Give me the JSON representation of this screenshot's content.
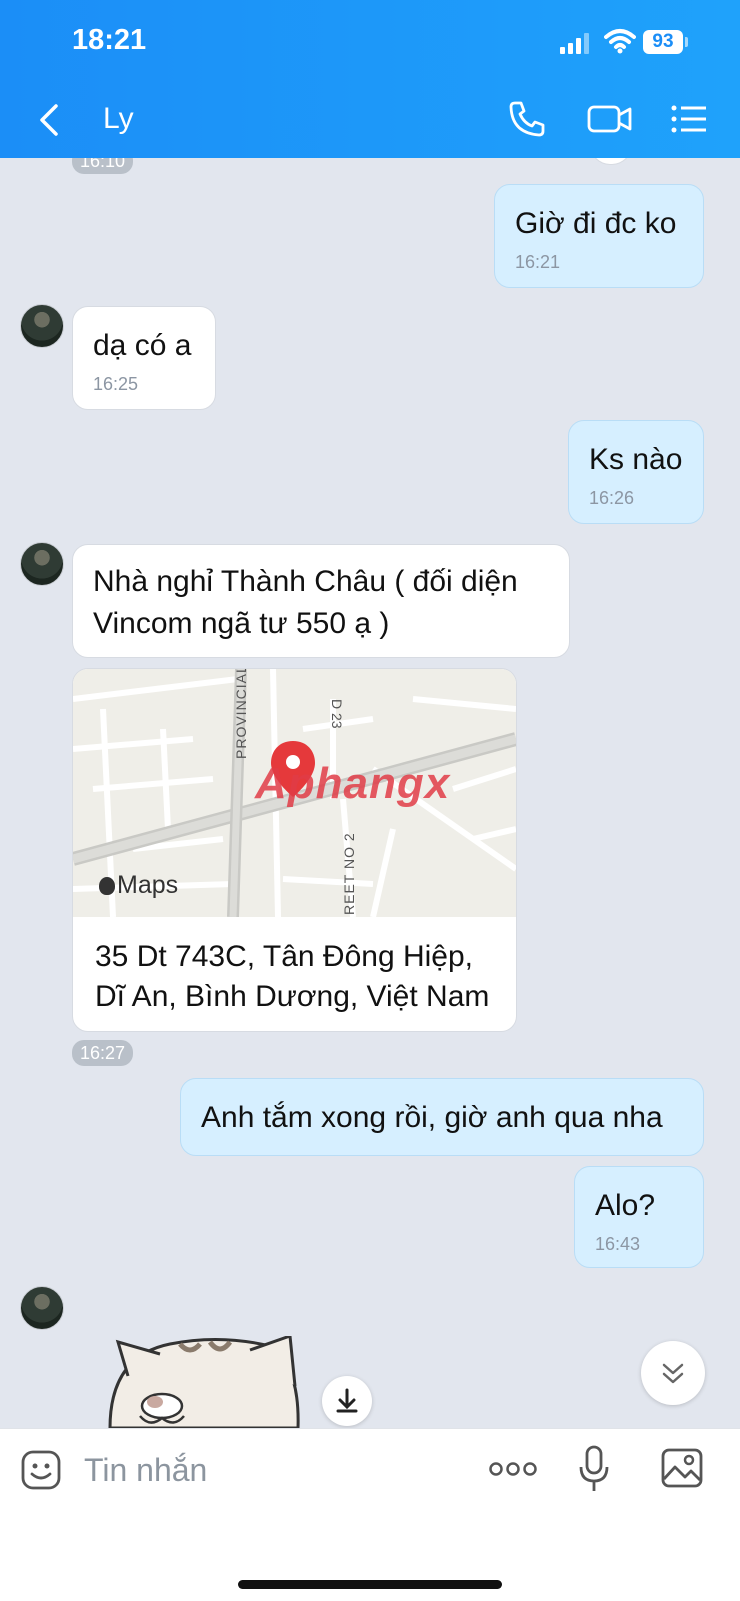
{
  "status_bar": {
    "time": "18:21",
    "battery": "93"
  },
  "header": {
    "contact_name": "Ly"
  },
  "messages": {
    "top_partial_time": "16:10",
    "m1": {
      "text": "Giờ đi đc ko",
      "time": "16:21"
    },
    "m2": {
      "text": "dạ có a",
      "time": "16:25"
    },
    "m3": {
      "text": "Ks nào",
      "time": "16:26"
    },
    "m4": {
      "line1": "Nhà nghỉ Thành Châu ( đối diện",
      "line2": "Vincom ngã tư 550 ạ )"
    },
    "location": {
      "map_label_provincial": "PROVINCIAL",
      "map_label_road": "D 23",
      "map_label_street": "REET NO 2",
      "maps_brand": "Maps",
      "watermark": "Aphangx",
      "address_line1": "35 Dt 743C, Tân Đông Hiệp,",
      "address_line2": "Dĩ An, Bình Dương, Việt Nam",
      "time": "16:27"
    },
    "m5": {
      "text": "Anh tắm xong rồi, giờ anh qua nha"
    },
    "m6": {
      "text": "Alo?",
      "time": "16:43"
    }
  },
  "composer": {
    "placeholder": "Tin nhắn"
  }
}
